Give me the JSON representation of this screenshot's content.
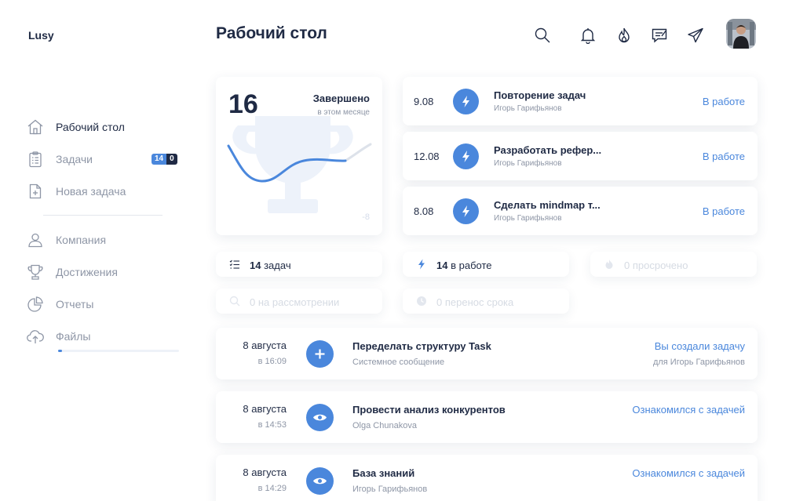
{
  "app": {
    "logo": "Lusy",
    "title": "Рабочий стол"
  },
  "topbar": {
    "icons": [
      "search-icon",
      "bell-icon",
      "fire-icon",
      "chat-icon",
      "send-icon"
    ],
    "avatar": "user-avatar"
  },
  "sidebar": {
    "items": [
      {
        "label": "Рабочий стол",
        "icon": "home-icon",
        "active": true
      },
      {
        "label": "Задачи",
        "icon": "clipboard-icon",
        "badge": [
          "14",
          "0"
        ]
      },
      {
        "label": "Новая задача",
        "icon": "new-file-icon"
      },
      {
        "label": "Компания",
        "icon": "users-icon"
      },
      {
        "label": "Достижения",
        "icon": "trophy-icon"
      },
      {
        "label": "Отчеты",
        "icon": "pie-chart-icon"
      },
      {
        "label": "Файлы",
        "icon": "cloud-upload-icon"
      }
    ]
  },
  "stats": {
    "value": "16",
    "title": "Завершено",
    "subtitle": "в этом месяце",
    "delta": "-8",
    "line_color": "#4a87dc"
  },
  "tasks": [
    {
      "date": "9.08",
      "title": "Повторение задач",
      "user": "Игорь Гарифьянов",
      "status": "В работе"
    },
    {
      "date": "12.08",
      "title": "Разработать рефер...",
      "user": "Игорь Гарифьянов",
      "status": "В работе"
    },
    {
      "date": "8.08",
      "title": "Сделать mindmap т...",
      "user": "Игорь Гарифьянов",
      "status": "В работе"
    }
  ],
  "filters": {
    "total": {
      "count": "14",
      "label": "задач"
    },
    "in_progress": {
      "count": "14",
      "label": "в работе"
    },
    "overdue": {
      "text": "0 просрочено"
    },
    "review": {
      "text": "0 на рассмотрении"
    },
    "postponed": {
      "text": "0 перенос срока"
    }
  },
  "feed": [
    {
      "date": "8 августа",
      "time": "в 16:09",
      "title": "Переделать структуру Task",
      "subtitle": "Системное сообщение",
      "action": "Вы создали задачу",
      "action_sub": "для Игорь Гарифьянов",
      "icon": "plus-icon"
    },
    {
      "date": "8 августа",
      "time": "в 14:53",
      "title": "Провести анализ конкурентов",
      "subtitle": "Olga Chunakova",
      "action": "Ознакомился с задачей",
      "action_sub": "",
      "icon": "eye-icon"
    },
    {
      "date": "8 августа",
      "time": "в 14:29",
      "title": "База знаний",
      "subtitle": "Игорь Гарифьянов",
      "action": "Ознакомился с задачей",
      "action_sub": "",
      "icon": "eye-icon"
    }
  ],
  "colors": {
    "accent": "#4a87dc",
    "text": "#1f2a44",
    "muted": "#8e96a6"
  }
}
